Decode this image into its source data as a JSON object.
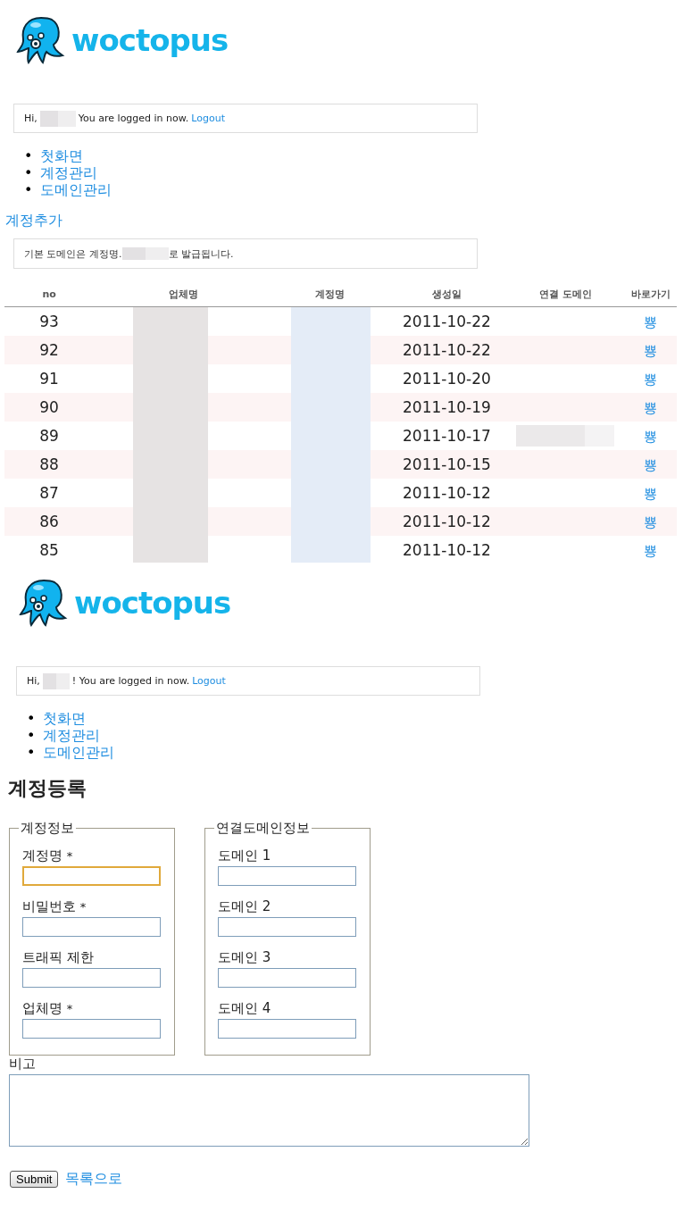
{
  "page1": {
    "header": {
      "logo": "woctopus",
      "hi": "Hi,",
      "message": "You are logged in now.",
      "logout": "Logout"
    },
    "nav": [
      {
        "bullet": "•",
        "label": "첫화면"
      },
      {
        "bullet": "•",
        "label": "계정관리"
      },
      {
        "bullet": "•",
        "label": "도메인관리"
      }
    ],
    "add_link": "계정추가",
    "notice": {
      "before": "기본 도메인은 계정명.",
      "after": "로 발급됩니다."
    },
    "table": {
      "columns": [
        "no",
        "업체명",
        "계정명",
        "생성일",
        "연결 도메인",
        "바로가기"
      ],
      "rows": [
        {
          "no": "93",
          "created": "2011-10-22",
          "domain_redacted": false,
          "link": "뿅"
        },
        {
          "no": "92",
          "created": "2011-10-22",
          "domain_redacted": false,
          "link": "뿅"
        },
        {
          "no": "91",
          "created": "2011-10-20",
          "domain_redacted": false,
          "link": "뿅"
        },
        {
          "no": "90",
          "created": "2011-10-19",
          "domain_redacted": false,
          "link": "뿅"
        },
        {
          "no": "89",
          "created": "2011-10-17",
          "domain_redacted": true,
          "link": "뿅"
        },
        {
          "no": "88",
          "created": "2011-10-15",
          "domain_redacted": false,
          "link": "뿅"
        },
        {
          "no": "87",
          "created": "2011-10-12",
          "domain_redacted": false,
          "link": "뿅"
        },
        {
          "no": "86",
          "created": "2011-10-12",
          "domain_redacted": false,
          "link": "뿅"
        },
        {
          "no": "85",
          "created": "2011-10-12",
          "domain_redacted": false,
          "link": "뿅"
        }
      ]
    }
  },
  "page2": {
    "header": {
      "logo": "woctopus",
      "hi": "Hi,",
      "message": "! You are logged in now.",
      "logout": "Logout"
    },
    "nav": [
      {
        "bullet": "•",
        "label": "첫화면"
      },
      {
        "bullet": "•",
        "label": "계정관리"
      },
      {
        "bullet": "•",
        "label": "도메인관리"
      }
    ],
    "title": "계정등록",
    "fieldsets": [
      {
        "legend": "계정정보",
        "fields": [
          {
            "label": "계정명",
            "required_mark": "*",
            "focused": true
          },
          {
            "label": "비밀번호",
            "required_mark": "*",
            "focused": false
          },
          {
            "label": "트래픽 제한",
            "focused": false
          },
          {
            "label": "업체명",
            "required_mark": "*",
            "focused": false
          }
        ]
      },
      {
        "legend": "연결도메인정보",
        "fields": [
          {
            "label": "도메인 1",
            "focused": false
          },
          {
            "label": "도메인 2",
            "focused": false
          },
          {
            "label": "도메인 3",
            "focused": false
          },
          {
            "label": "도메인 4",
            "focused": false
          }
        ]
      }
    ],
    "memo_label": "비고",
    "submit": "Submit",
    "back_link": "목록으로"
  }
}
